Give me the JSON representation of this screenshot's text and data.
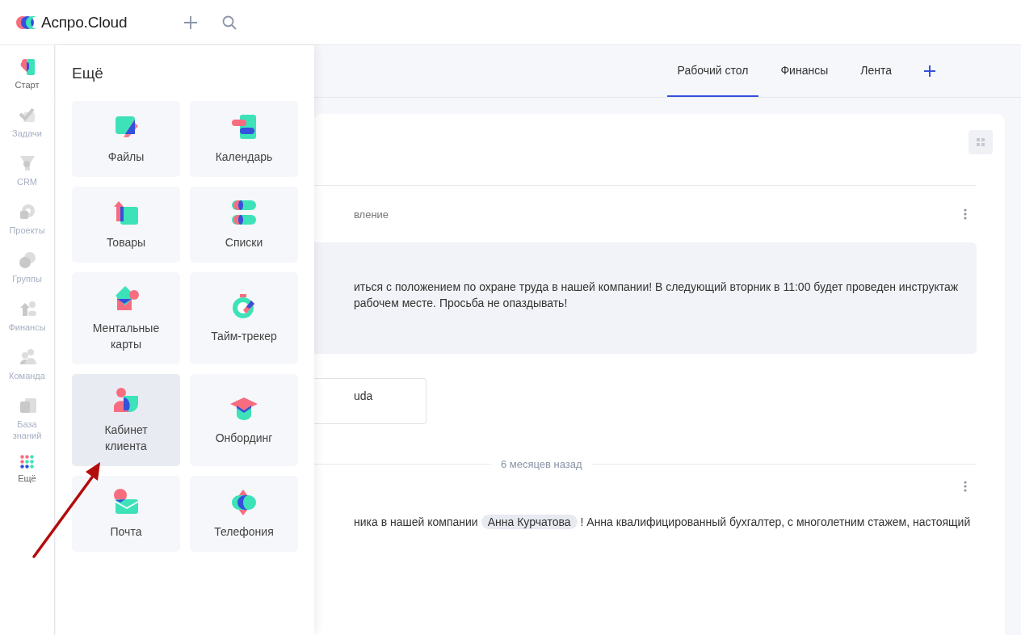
{
  "header": {
    "logo_text": "Аспро.Cloud"
  },
  "rail": [
    {
      "label": "Старт",
      "highlighted": true
    },
    {
      "label": "Задачи",
      "highlighted": false
    },
    {
      "label": "CRM",
      "highlighted": false
    },
    {
      "label": "Проекты",
      "highlighted": false
    },
    {
      "label": "Группы",
      "highlighted": false
    },
    {
      "label": "Финансы",
      "highlighted": false
    },
    {
      "label": "Команда",
      "highlighted": false
    },
    {
      "label": "База знаний",
      "highlighted": false
    },
    {
      "label": "Ещё",
      "highlighted": true
    }
  ],
  "more_panel": {
    "title": "Ещё",
    "tiles": [
      {
        "label": "Файлы",
        "hovered": false
      },
      {
        "label": "Календарь",
        "hovered": false
      },
      {
        "label": "Товары",
        "hovered": false
      },
      {
        "label": "Списки",
        "hovered": false
      },
      {
        "label": "Ментальные карты",
        "hovered": false
      },
      {
        "label": "Тайм-трекер",
        "hovered": false
      },
      {
        "label": "Кабинет клиента",
        "hovered": true
      },
      {
        "label": "Онбординг",
        "hovered": false
      },
      {
        "label": "Почта",
        "hovered": false
      },
      {
        "label": "Телефония",
        "hovered": false
      }
    ]
  },
  "tabs": [
    {
      "label": "Рабочий стол",
      "selected": true
    },
    {
      "label": "Финансы",
      "selected": false
    },
    {
      "label": "Лента",
      "selected": false
    }
  ],
  "feed": {
    "post_type": "вление",
    "message_lines": [
      "иться с положением по охране труда в нашей компании! В следующий вторник в 11:00 будет проведен инструктаж",
      "рабочем месте. Просьба не опаздывать!"
    ],
    "attachment": "uda",
    "separator": "6 месяцев назад",
    "second_post": {
      "before": "ника в нашей компании",
      "mention": "Анна Курчатова",
      "after": "! Анна квалифицированный бухгалтер, с многолетним стажем, настоящий"
    }
  }
}
